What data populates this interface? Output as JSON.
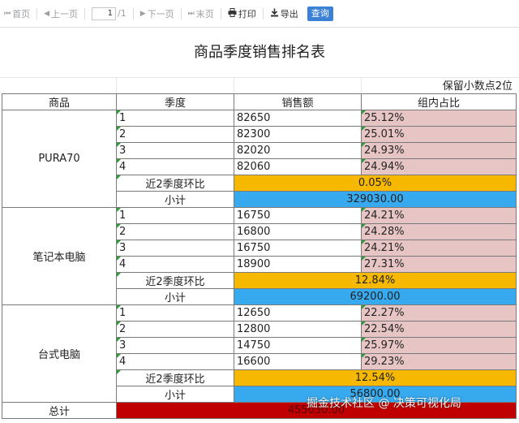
{
  "toolbar": {
    "first": "首页",
    "prev": "上一页",
    "page_value": "1",
    "page_total": "/1",
    "next": "下一页",
    "last": "末页",
    "print": "打印",
    "export": "导出",
    "query": "查询",
    "icons": {
      "first": "skip-first-icon",
      "prev": "triangle-left-icon",
      "next": "triangle-right-icon",
      "last": "skip-last-icon",
      "print": "printer-icon",
      "export": "download-icon"
    }
  },
  "report": {
    "title": "商品季度销售排名表",
    "note": "保留小数点2位",
    "headers": {
      "product": "商品",
      "quarter": "季度",
      "sales": "销售额",
      "share": "组内占比"
    },
    "groups": [
      {
        "product": "PURA70",
        "rows": [
          {
            "quarter": "1",
            "sales": "82650",
            "share": "25.12%"
          },
          {
            "quarter": "2",
            "sales": "82300",
            "share": "25.01%"
          },
          {
            "quarter": "3",
            "sales": "82020",
            "share": "24.93%"
          },
          {
            "quarter": "4",
            "sales": "82060",
            "share": "24.94%"
          }
        ],
        "ratio_label": "近2季度环比",
        "ratio_value": "0.05%",
        "subtotal_label": "小计",
        "subtotal_value": "329030.00"
      },
      {
        "product": "笔记本电脑",
        "rows": [
          {
            "quarter": "1",
            "sales": "16750",
            "share": "24.21%"
          },
          {
            "quarter": "2",
            "sales": "16800",
            "share": "24.28%"
          },
          {
            "quarter": "3",
            "sales": "16750",
            "share": "24.21%"
          },
          {
            "quarter": "4",
            "sales": "18900",
            "share": "27.31%"
          }
        ],
        "ratio_label": "近2季度环比",
        "ratio_value": "12.84%",
        "subtotal_label": "小计",
        "subtotal_value": "69200.00"
      },
      {
        "product": "台式电脑",
        "rows": [
          {
            "quarter": "1",
            "sales": "12650",
            "share": "22.27%"
          },
          {
            "quarter": "2",
            "sales": "12800",
            "share": "22.54%"
          },
          {
            "quarter": "3",
            "sales": "14750",
            "share": "25.97%"
          },
          {
            "quarter": "4",
            "sales": "16600",
            "share": "29.23%"
          }
        ],
        "ratio_label": "近2季度环比",
        "ratio_value": "12.54%",
        "subtotal_label": "小计",
        "subtotal_value": "56800.00"
      }
    ],
    "total_label": "总计",
    "total_value": "455030.00"
  },
  "watermark": "掘金技术社区 @ 决策可视化局",
  "colors": {
    "share_bg": "#e8c5c5",
    "ratio_bg": "#f6b800",
    "subtotal_bg": "#37a9ee",
    "total_bg": "#c00000",
    "query_btn": "#3b82d6"
  }
}
